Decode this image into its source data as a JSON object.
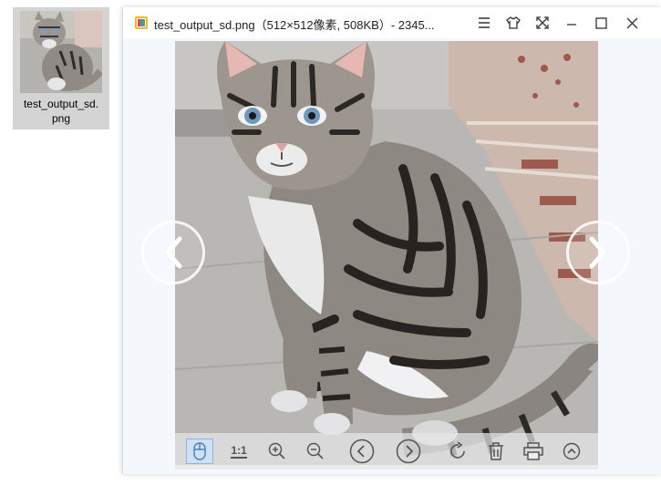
{
  "desktop": {
    "file_label": "test_output_sd.\npng"
  },
  "window": {
    "title": "test_output_sd.png（512×512像素, 508KB）- 2345...",
    "controls": {
      "menu": "menu",
      "skin": "skin",
      "fullscreen": "fullscreen",
      "minimize": "minimize",
      "maximize": "maximize",
      "close": "close"
    }
  },
  "toolbar": {
    "actual_size_label": "1:1",
    "tools": [
      "hand-tool",
      "actual-size",
      "zoom-in",
      "zoom-out",
      "previous",
      "next",
      "rotate",
      "delete",
      "print",
      "more"
    ]
  },
  "colors": {
    "accent": "#3f8fd9",
    "toolbar_bg": "#e6e6e8",
    "window_bg": "#f4f8fc"
  }
}
